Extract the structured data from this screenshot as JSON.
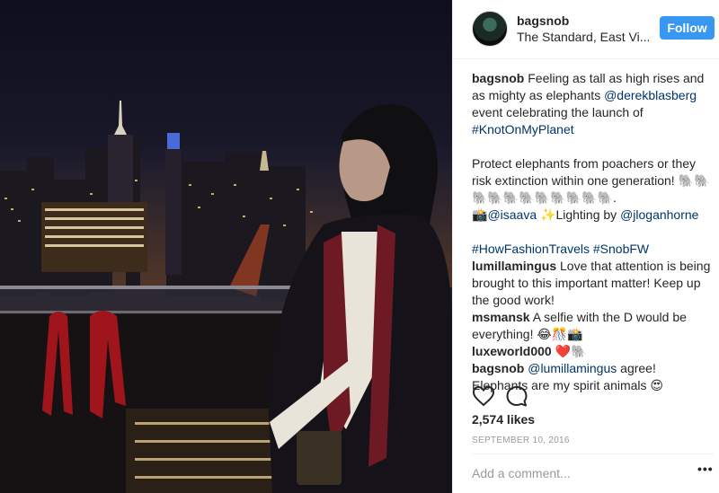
{
  "post": {
    "username": "bagsnob",
    "location": "The Standard, East Vi...",
    "follow_label": "Follow",
    "caption": {
      "user": "bagsnob",
      "text1": " Feeling as tall as high rises and as mighty as elephants ",
      "mention1": "@derekblasberg",
      "text2": " event celebrating the launch of ",
      "hashtag1": "#KnotOnMyPlanet",
      "text3": "Protect elephants from poachers or they risk extinction within one generation! 🐘🐘🐘🐘🐘🐘🐘🐘🐘🐘🐘.",
      "credit_prefix": "📸",
      "mention2": "@isaava",
      "credit_mid": " ✨Lighting by ",
      "mention3": "@jloganhorne",
      "hashtag2": "#HowFashionTravels",
      "hashtag3": "#SnobFW"
    },
    "comments": [
      {
        "user": "lumillamingus",
        "text": " Love that attention is being brought to this important matter! Keep up the good work!"
      },
      {
        "user": "msmansk",
        "text": " A selfie with the D would be everything! 😂🎊📸"
      },
      {
        "user": "luxeworld000",
        "text": " ❤️🐘"
      },
      {
        "user": "bagsnob",
        "mention": "@lumillamingus",
        "text": " agree! Elephants are my spirit animals 😍"
      }
    ],
    "likes": "2,574 likes",
    "date": "SEPTEMBER 10, 2016",
    "add_comment_placeholder": "Add a comment...",
    "more_label": "•••"
  },
  "icons": {
    "like": "heart-icon",
    "comment": "comment-icon"
  },
  "colors": {
    "follow": "#3897f0",
    "link": "#003569",
    "muted": "#999999"
  }
}
